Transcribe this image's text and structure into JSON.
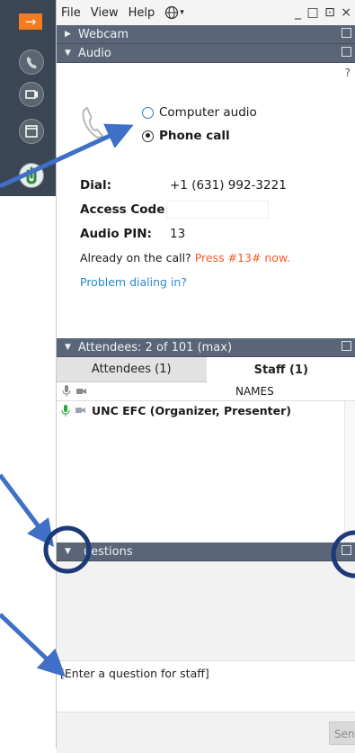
{
  "dock": {
    "icons": [
      "exit-arrow-icon",
      "phone-icon",
      "camera-icon",
      "screen-icon",
      "raise-hand-icon"
    ]
  },
  "menubar": {
    "items": [
      "File",
      "View",
      "Help"
    ],
    "globe_icon": "globe-icon",
    "window_controls": "_ □ ⊡ ×"
  },
  "webcam_header": {
    "label": "Webcam"
  },
  "audio_header": {
    "label": "Audio"
  },
  "audio": {
    "help": "?",
    "options": [
      {
        "label": "Computer audio",
        "selected": false
      },
      {
        "label": "Phone call",
        "selected": true
      }
    ],
    "dial_label": "Dial:",
    "dial_value": "+1 (631) 992-3221",
    "access_label": "Access Code:",
    "access_value": "",
    "pin_label": "Audio PIN:",
    "pin_value": "13",
    "already_prefix": "Already on the call?",
    "already_action": "Press #13# now.",
    "problem_link": "Problem dialing in?"
  },
  "attendees_header": {
    "label": "Attendees:  2 of 101 (max)"
  },
  "tabs": [
    {
      "label": "Attendees (1)",
      "active": false
    },
    {
      "label": "Staff (1)",
      "active": true
    }
  ],
  "names_header": {
    "label": "NAMES"
  },
  "attendees": [
    {
      "name": "UNC EFC (Organizer, Presenter)"
    }
  ],
  "questions_header": {
    "label": "uestions"
  },
  "questions": {
    "placeholder": "[Enter a question for staff]",
    "send_label": "Send"
  },
  "colors": {
    "header_bg": "#5a6677",
    "annotation_blue": "#3f6fc6",
    "circle_navy": "#1d3a78",
    "accent_orange": "#f25c2a",
    "link_blue": "#2b88c9"
  }
}
